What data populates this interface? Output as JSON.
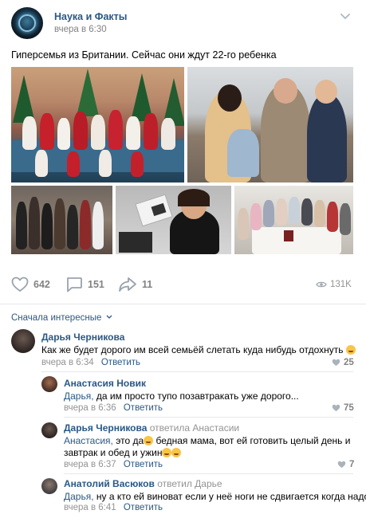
{
  "post": {
    "group_name": "Наука и Факты",
    "time": "вчера в 6:30",
    "text": "Гиперсемья из Британии. Сейчас они ждут 22-го ребенка",
    "likes": "642",
    "comments": "151",
    "shares": "11",
    "views": "131K"
  },
  "photos": [
    {
      "icon": "family-christmas-photo"
    },
    {
      "icon": "parents-with-children-photo"
    },
    {
      "icon": "family-walking-photo"
    },
    {
      "icon": "woman-with-ultrasound-photo"
    },
    {
      "icon": "family-at-table-photo"
    }
  ],
  "comments_section": {
    "sort_label": "Сначала интересные"
  },
  "comments": [
    {
      "author": "Дарья Черникова",
      "reply_to": "",
      "addressee": "",
      "text": "Как же будет дорого им всей семьёй слетать куда нибудь отдохнуть",
      "time": "вчера в 6:34",
      "reply_label": "Ответить",
      "likes": "25"
    },
    {
      "author": "Анастасия Новик",
      "reply_to": "",
      "addressee": "Дарья,",
      "text": "да им просто тупо позавтракать уже дорого...",
      "time": "вчера в 6:36",
      "reply_label": "Ответить",
      "likes": "75"
    },
    {
      "author": "Дарья Черникова",
      "reply_to": "ответила Анастасии",
      "addressee": "Анастасия,",
      "text": "это да",
      "text2": "бедная мама, вот ей готовить целый день и",
      "text3": "завтрак и обед и ужин",
      "time": "вчера в 6:37",
      "reply_label": "Ответить",
      "likes": "7"
    },
    {
      "author": "Анатолий Васюков",
      "reply_to": "ответил Дарье",
      "addressee": "Дарья,",
      "text": "ну а кто ей виноват если у неё ноги не сдвигается когда надо...",
      "time": "вчера в 6:41",
      "reply_label": "Ответить",
      "likes": ""
    }
  ],
  "colors": {
    "link": "#2a5885",
    "muted": "#828282",
    "divider": "#e7e8ec"
  }
}
